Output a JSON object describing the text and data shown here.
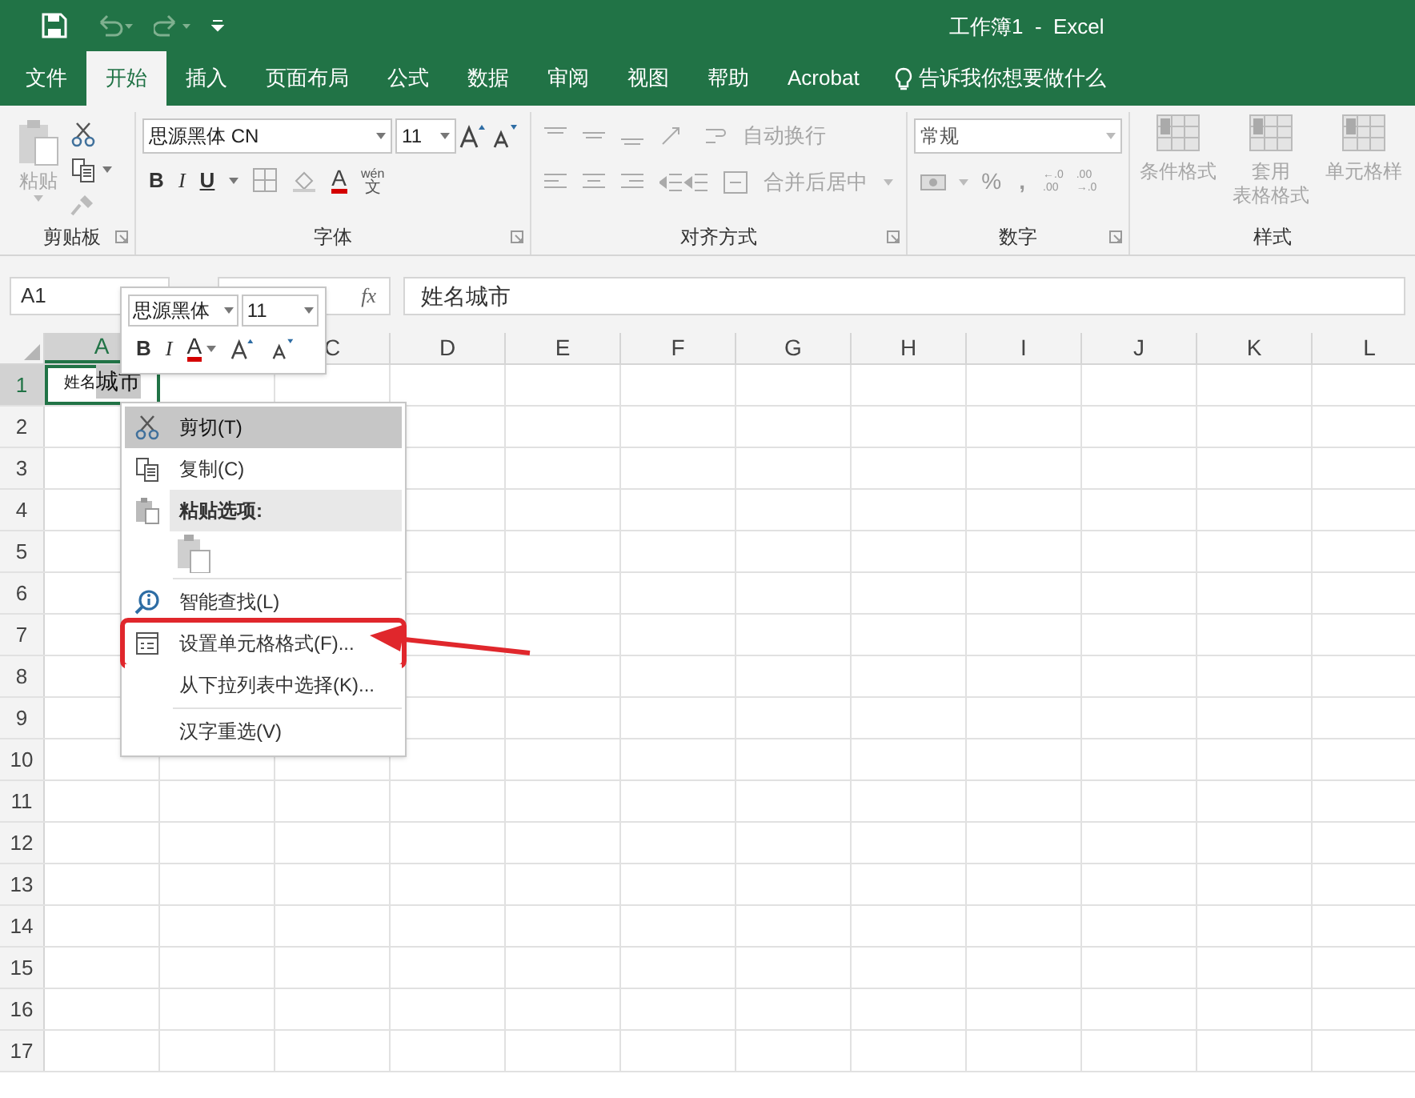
{
  "title_bar": {
    "title": "工作簿1  -  Excel"
  },
  "tabs": [
    {
      "label": "文件",
      "selected": false
    },
    {
      "label": "开始",
      "selected": true
    },
    {
      "label": "插入",
      "selected": false
    },
    {
      "label": "页面布局",
      "selected": false
    },
    {
      "label": "公式",
      "selected": false
    },
    {
      "label": "数据",
      "selected": false
    },
    {
      "label": "审阅",
      "selected": false
    },
    {
      "label": "视图",
      "selected": false
    },
    {
      "label": "帮助",
      "selected": false
    },
    {
      "label": "Acrobat",
      "selected": false
    }
  ],
  "tell_me": "告诉我你想要做什么",
  "ribbon": {
    "clipboard": {
      "paste": "粘贴",
      "label": "剪贴板"
    },
    "font": {
      "font_name": "思源黑体 CN",
      "font_size": "11",
      "format_buttons": [
        "B",
        "I",
        "U"
      ],
      "font_color": "A",
      "phonetic": [
        "wén",
        "文"
      ],
      "label": "字体"
    },
    "alignment": {
      "wrap": "自动换行",
      "merge": "合并后居中",
      "label": "对齐方式"
    },
    "number": {
      "format": "常规",
      "percent": "%",
      "comma": ",",
      "decimals": [
        [
          "←.0",
          ".00"
        ],
        [
          ".00",
          "→.0"
        ]
      ],
      "label": "数字"
    },
    "styles": {
      "items": [
        [
          "条件格式"
        ],
        [
          "套用",
          "表格格式"
        ],
        [
          "单元格样"
        ]
      ],
      "label": "样式"
    }
  },
  "formula_bar": {
    "name_box": "A1",
    "fx": "fx",
    "formula": "姓名城市"
  },
  "sheet": {
    "columns": [
      {
        "label": "A",
        "selected": true
      },
      {
        "label": "C",
        "selected": false
      },
      {
        "label": "D",
        "selected": false
      },
      {
        "label": "E",
        "selected": false
      },
      {
        "label": "F",
        "selected": false
      },
      {
        "label": "G",
        "selected": false
      },
      {
        "label": "H",
        "selected": false
      },
      {
        "label": "I",
        "selected": false
      },
      {
        "label": "J",
        "selected": false
      },
      {
        "label": "K",
        "selected": false
      },
      {
        "label": "L",
        "selected": false
      }
    ],
    "rows": [
      {
        "label": "1",
        "selected": true
      },
      {
        "label": "2",
        "selected": false
      },
      {
        "label": "3",
        "selected": false
      },
      {
        "label": "4",
        "selected": false
      },
      {
        "label": "5",
        "selected": false
      },
      {
        "label": "6",
        "selected": false
      },
      {
        "label": "7",
        "selected": false
      },
      {
        "label": "8",
        "selected": false
      },
      {
        "label": "9",
        "selected": false
      },
      {
        "label": "10",
        "selected": false
      },
      {
        "label": "11",
        "selected": false
      },
      {
        "label": "12",
        "selected": false
      },
      {
        "label": "13",
        "selected": false
      },
      {
        "label": "14",
        "selected": false
      },
      {
        "label": "15",
        "selected": false
      },
      {
        "label": "16",
        "selected": false
      },
      {
        "label": "17",
        "selected": false
      }
    ],
    "active_cell": [
      {
        "text": "姓名",
        "selected": false
      },
      {
        "text": "城市",
        "selected": true
      }
    ]
  },
  "mini_toolbar": {
    "font_name": "思源黑体",
    "font_size": "11",
    "buttons": [
      "B",
      "I",
      "A"
    ]
  },
  "context_menu": [
    {
      "kind": "item",
      "label": "剪切(T)",
      "selected": true,
      "annotated": false
    },
    {
      "kind": "item",
      "label": "复制(C)",
      "selected": false,
      "annotated": false
    },
    {
      "kind": "header",
      "label": "粘贴选项:"
    },
    {
      "kind": "paste_options"
    },
    {
      "kind": "separator"
    },
    {
      "kind": "item",
      "label": "智能查找(L)",
      "selected": false,
      "annotated": false
    },
    {
      "kind": "item",
      "label": "设置单元格格式(F)...",
      "selected": false,
      "annotated": true
    },
    {
      "kind": "item",
      "label": "从下拉列表中选择(K)...",
      "selected": false,
      "annotated": false
    },
    {
      "kind": "separator"
    },
    {
      "kind": "item",
      "label": "汉字重选(V)",
      "selected": false,
      "annotated": false
    }
  ]
}
